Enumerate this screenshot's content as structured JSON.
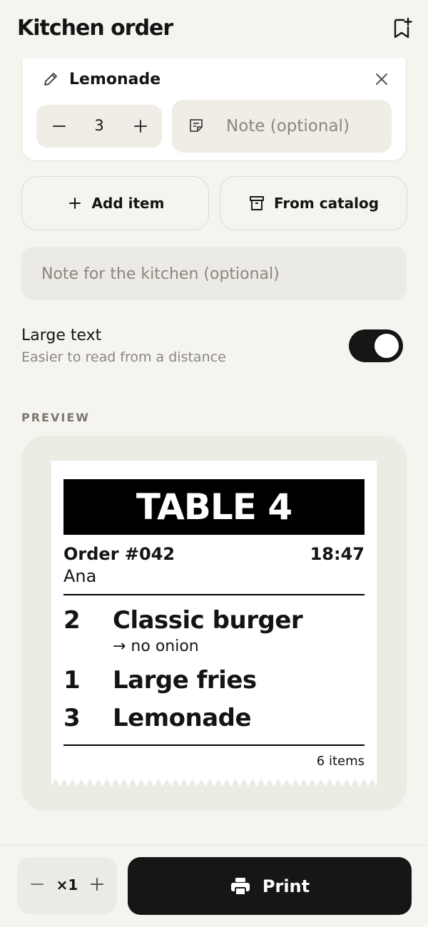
{
  "header": {
    "title": "Kitchen order"
  },
  "item_card": {
    "name": "Lemonade",
    "quantity": "3",
    "note_placeholder": "Note (optional)"
  },
  "actions": {
    "add_item_label": "Add item",
    "from_catalog_label": "From catalog"
  },
  "kitchen_note": {
    "placeholder": "Note for the kitchen (optional)"
  },
  "large_text": {
    "title": "Large text",
    "subtitle": "Easier to read from a distance",
    "enabled": true
  },
  "preview": {
    "label": "PREVIEW",
    "receipt": {
      "table": "TABLE 4",
      "order_number": "Order #042",
      "time": "18:47",
      "customer": "Ana",
      "lines": [
        {
          "qty": "2",
          "name": "Classic burger",
          "modifier": "→ no onion"
        },
        {
          "qty": "1",
          "name": "Large fries"
        },
        {
          "qty": "3",
          "name": "Lemonade"
        }
      ],
      "item_count": "6 items"
    }
  },
  "bottom_bar": {
    "copies": "×1",
    "print_label": "Print"
  },
  "colors": {
    "accent": "#161616",
    "background": "#f5f4ef",
    "muted": "#8a8780"
  }
}
